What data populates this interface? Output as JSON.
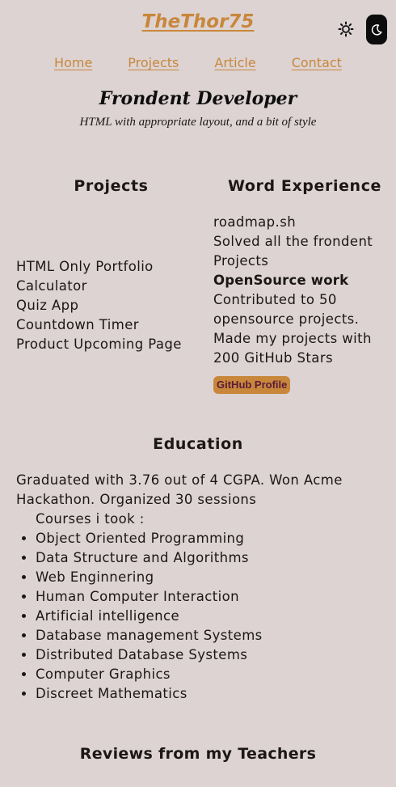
{
  "site": {
    "logo": "TheThor75"
  },
  "nav": [
    "Home",
    "Projects",
    "Article",
    "Contact"
  ],
  "intro": {
    "title": "Frondent Developer",
    "subtitle": "HTML with appropriate layout, and a bit of style"
  },
  "projects": {
    "heading": "Projects",
    "items": [
      "HTML Only Portfolio",
      "Calculator",
      "Quiz App",
      "Countdown Timer",
      "Product Upcoming Page"
    ]
  },
  "experience": {
    "heading": "Word Experience",
    "line1": "roadmap.sh",
    "line2": "Solved all the frondent Projects",
    "bold": "OpenSource work",
    "line3": "Contributed to 50 opensource projects. Made my projects with 200 GitHub Stars",
    "button": "GitHub Profile"
  },
  "education": {
    "heading": "Education",
    "summary": "Graduated with 3.76 out of 4 CGPA. Won Acme Hackathon. Organized 30 sessions",
    "courses_title": "Courses i took :",
    "courses": [
      "Object Oriented Programming",
      "Data Structure and Algorithms",
      "Web Enginnering",
      "Human Computer Interaction",
      "Artificial intelligence",
      "Database management Systems",
      "Distributed Database Systems",
      "Computer Graphics",
      "Discreet Mathematics"
    ]
  },
  "reviews": {
    "heading": "Reviews from my Teachers"
  },
  "colors": {
    "background": "#ddd3d3",
    "accent": "#c8873a",
    "text": "#1c1616"
  },
  "icons": {
    "light_mode": "sun-icon",
    "dark_mode": "moon-icon"
  }
}
